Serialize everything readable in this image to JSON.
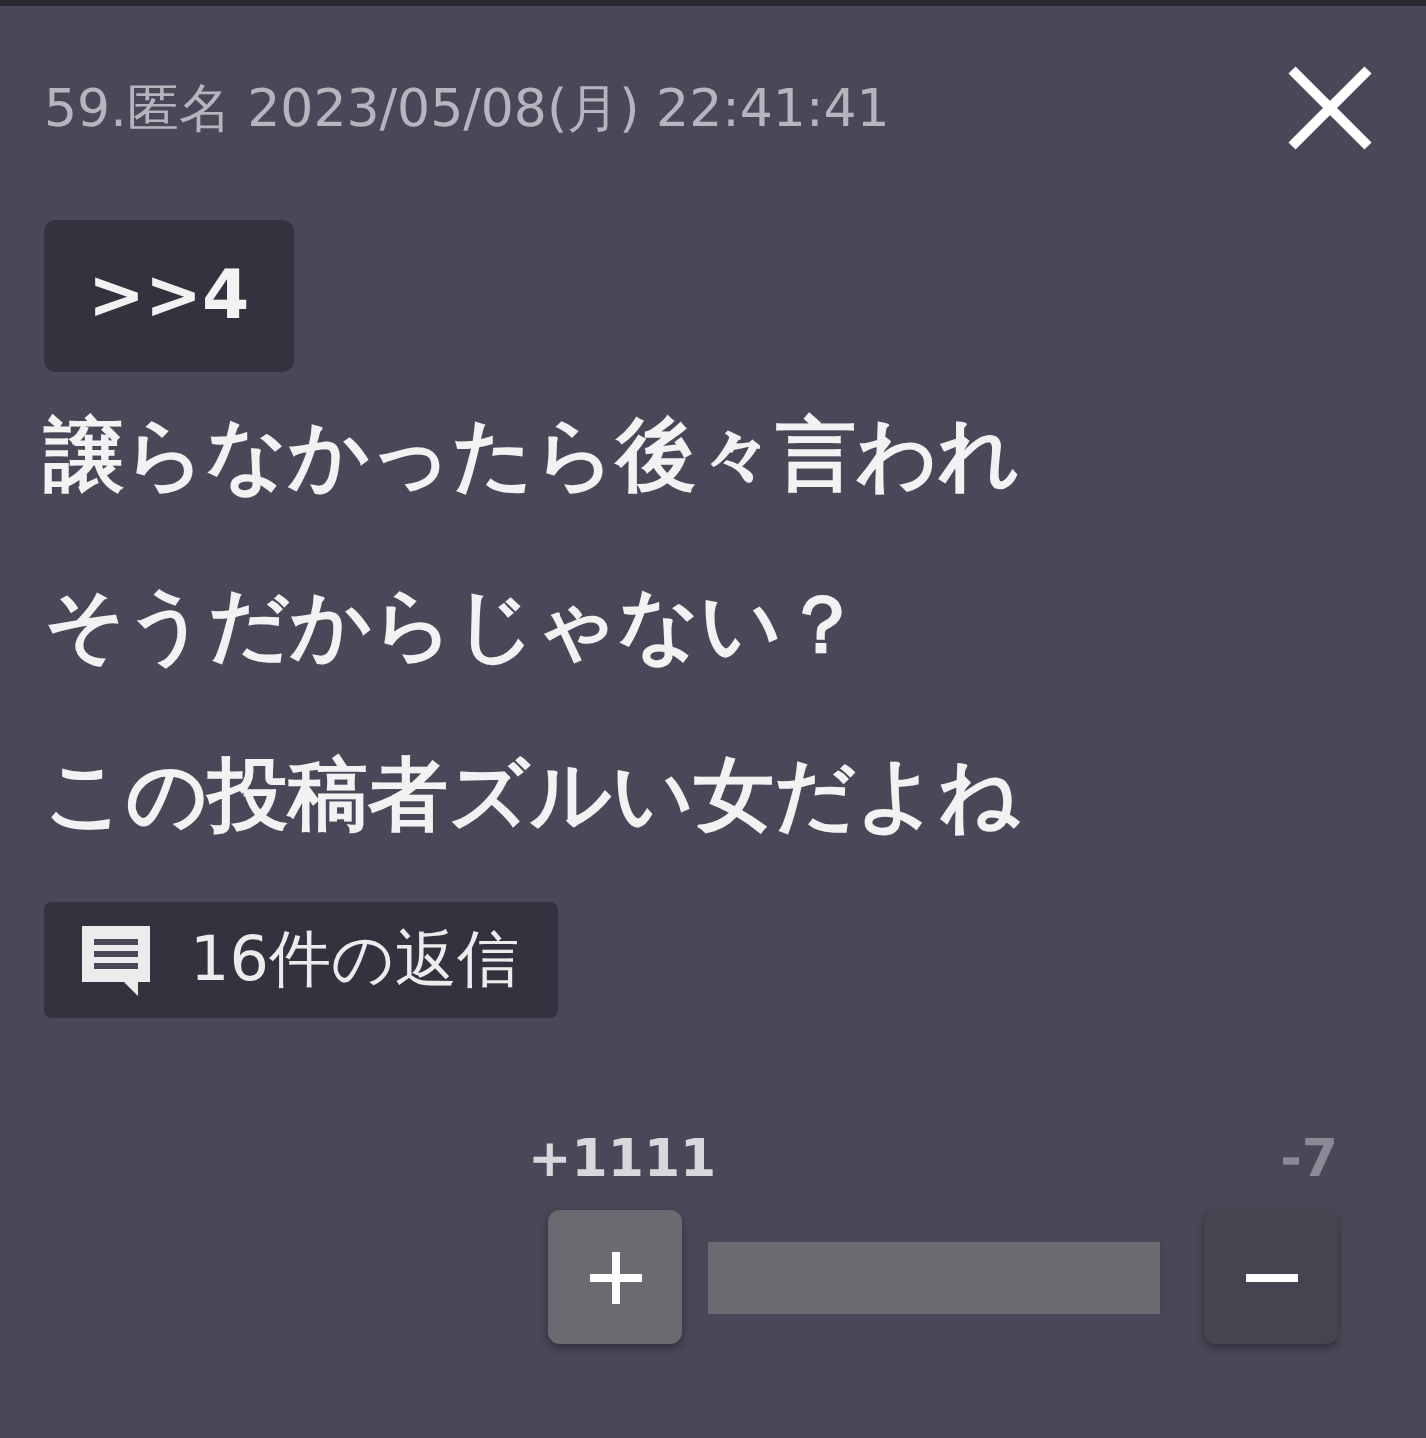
{
  "header": {
    "meta": "59.匿名 2023/05/08(月) 22:41:41"
  },
  "anchor": ">>4",
  "body_lines": [
    "譲らなかったら後々言われ",
    "そうだからじゃない？",
    "この投稿者ズルい女だよね"
  ],
  "replies": {
    "label": "16件の返信"
  },
  "vote": {
    "plus_score": "+1111",
    "minus_score": "-7",
    "level": 0.99
  }
}
